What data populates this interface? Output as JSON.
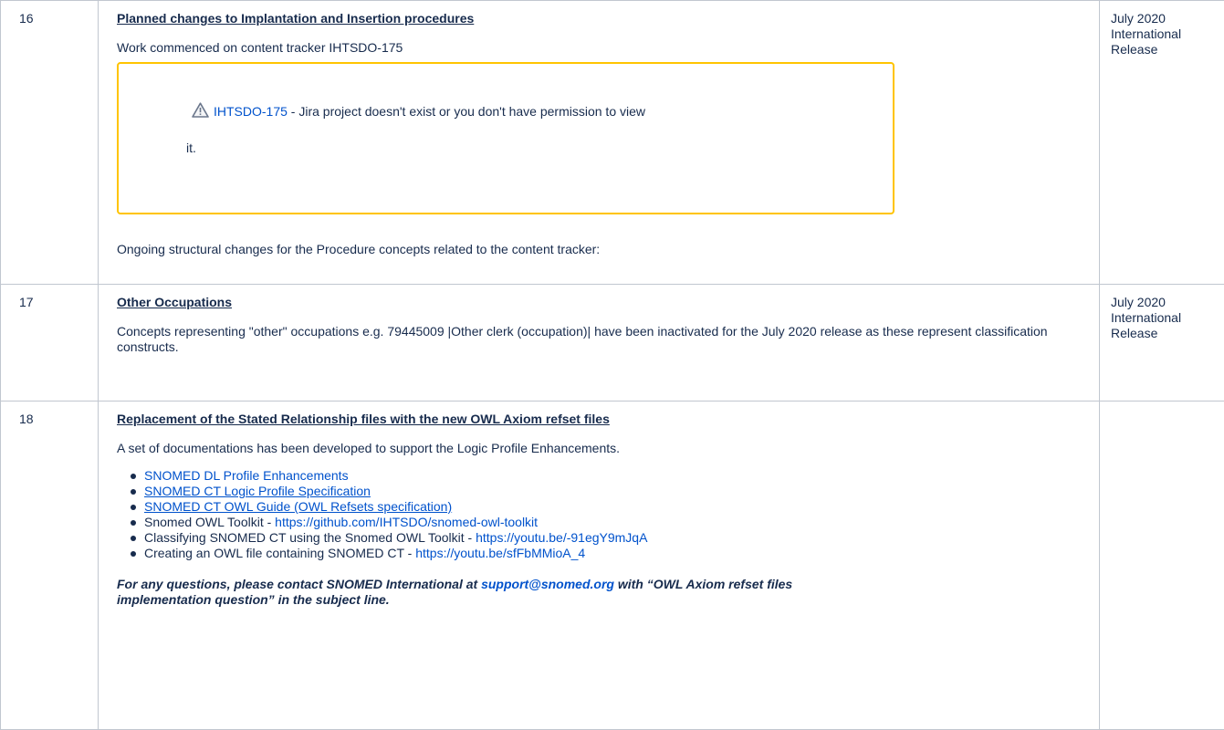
{
  "rows": [
    {
      "number": "16",
      "title": "Planned changes to Implantation and Insertion procedures",
      "intro": "Work commenced on content tracker IHTSDO-175",
      "jira": {
        "key": "IHTSDO-175",
        "message_line1": " - Jira project doesn't exist or you don't have permission to view",
        "message_line2": "it."
      },
      "followup": "Ongoing structural changes for the Procedure concepts related to the content tracker:",
      "release": [
        "July 2020",
        "International",
        "Release"
      ]
    },
    {
      "number": "17",
      "title": "Other Occupations",
      "body": "Concepts representing \"other\" occupations e.g. 79445009 |Other clerk (occupation)| have been inactivated for the July 2020 release as these represent classification constructs.",
      "release": [
        "July 2020",
        "International",
        "Release"
      ]
    },
    {
      "number": "18",
      "title": "Replacement of the Stated Relationship files with the new OWL Axiom refset files",
      "intro": "A set of documentations has been developed to support the Logic Profile Enhancements.",
      "links": [
        {
          "text": "SNOMED DL Profile Enhancements"
        },
        {
          "text": "SNOMED CT Logic Profile Specification"
        },
        {
          "text": "SNOMED CT OWL Guide (OWL Refsets specification)"
        },
        {
          "prefix": "Snomed OWL Toolkit - ",
          "text": "https://github.com/IHTSDO/snomed-owl-toolkit"
        },
        {
          "prefix": "Classifying SNOMED CT using the Snomed OWL Toolkit - ",
          "text": "https://youtu.be/-91egY9mJqA"
        },
        {
          "prefix": "Creating an OWL file containing SNOMED CT - ",
          "text": "https://youtu.be/sfFbMMioA_4"
        }
      ],
      "contact": {
        "before": "For any questions, please contact SNOMED International at ",
        "email": "support@snomed.org",
        "after": " with “OWL Axiom refset files implementation question” in the subject line."
      },
      "release": ""
    }
  ],
  "colors": {
    "border": "#c1c7d0",
    "text": "#172b4d",
    "link": "#0052cc",
    "warning_border": "#ffc400"
  },
  "icons": {
    "jira_warning": "warning-icon"
  }
}
